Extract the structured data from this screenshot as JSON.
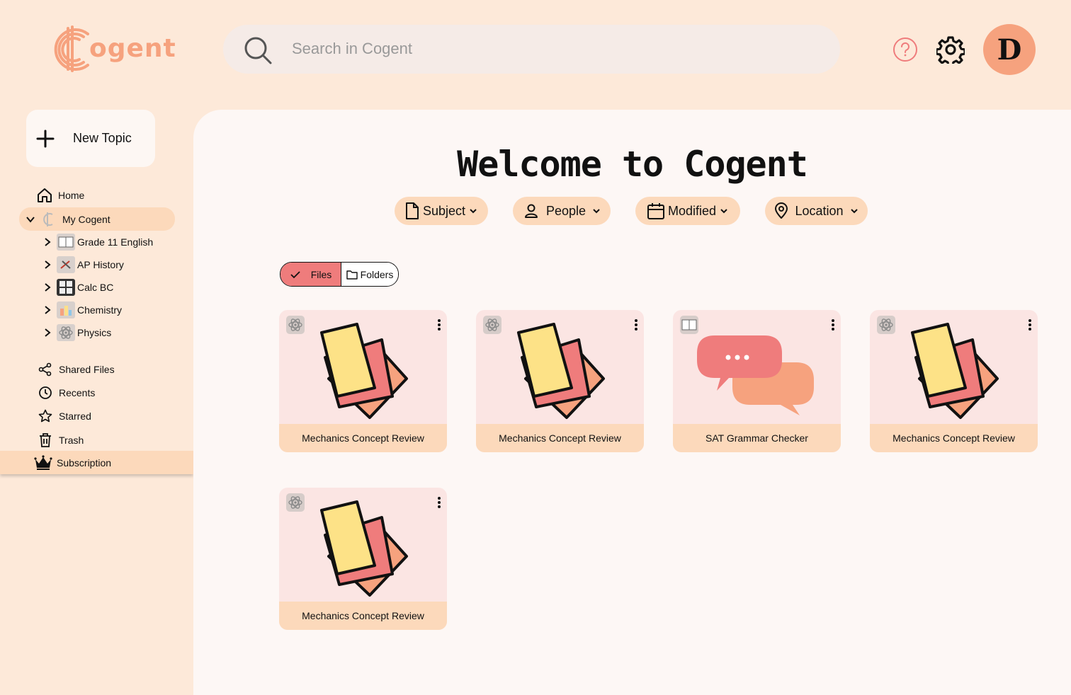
{
  "header": {
    "logo_text": "ogent",
    "search_placeholder": "Search in Cogent",
    "avatar_initial": "D"
  },
  "sidebar": {
    "new_topic_label": "New Topic",
    "home_label": "Home",
    "my_cogent_label": "My Cogent",
    "topics": [
      {
        "label": "Grade 11 English",
        "icon": "book-icon"
      },
      {
        "label": "AP History",
        "icon": "history-icon"
      },
      {
        "label": "Calc BC",
        "icon": "calculator-icon"
      },
      {
        "label": "Chemistry",
        "icon": "flask-icon"
      },
      {
        "label": "Physics",
        "icon": "atom-icon"
      }
    ],
    "shared_label": "Shared Files",
    "recents_label": "Recents",
    "starred_label": "Starred",
    "trash_label": "Trash",
    "subscription_label": "Subscription"
  },
  "main": {
    "title": "Welcome to Cogent",
    "filters": {
      "subject": "Subject",
      "people": "People",
      "modified": "Modified",
      "location": "Location"
    },
    "toggle": {
      "files": "Files",
      "folders": "Folders",
      "selected": "Files"
    },
    "cards": [
      {
        "title": "Mechanics Concept Review",
        "type": "flashcards",
        "tag": "atom-icon"
      },
      {
        "title": "Mechanics Concept Review",
        "type": "flashcards",
        "tag": "atom-icon"
      },
      {
        "title": "SAT Grammar Checker",
        "type": "chat",
        "tag": "book-icon"
      },
      {
        "title": "Mechanics Concept Review",
        "type": "flashcards",
        "tag": "atom-icon"
      },
      {
        "title": "Mechanics Concept Review",
        "type": "flashcards",
        "tag": "atom-icon"
      }
    ]
  },
  "colors": {
    "background": "#fde9d9",
    "accent": "#f6a27e",
    "highlight": "#fcd9bb",
    "files_toggle": "#ef7c7c",
    "panel": "#fdf7f5"
  }
}
